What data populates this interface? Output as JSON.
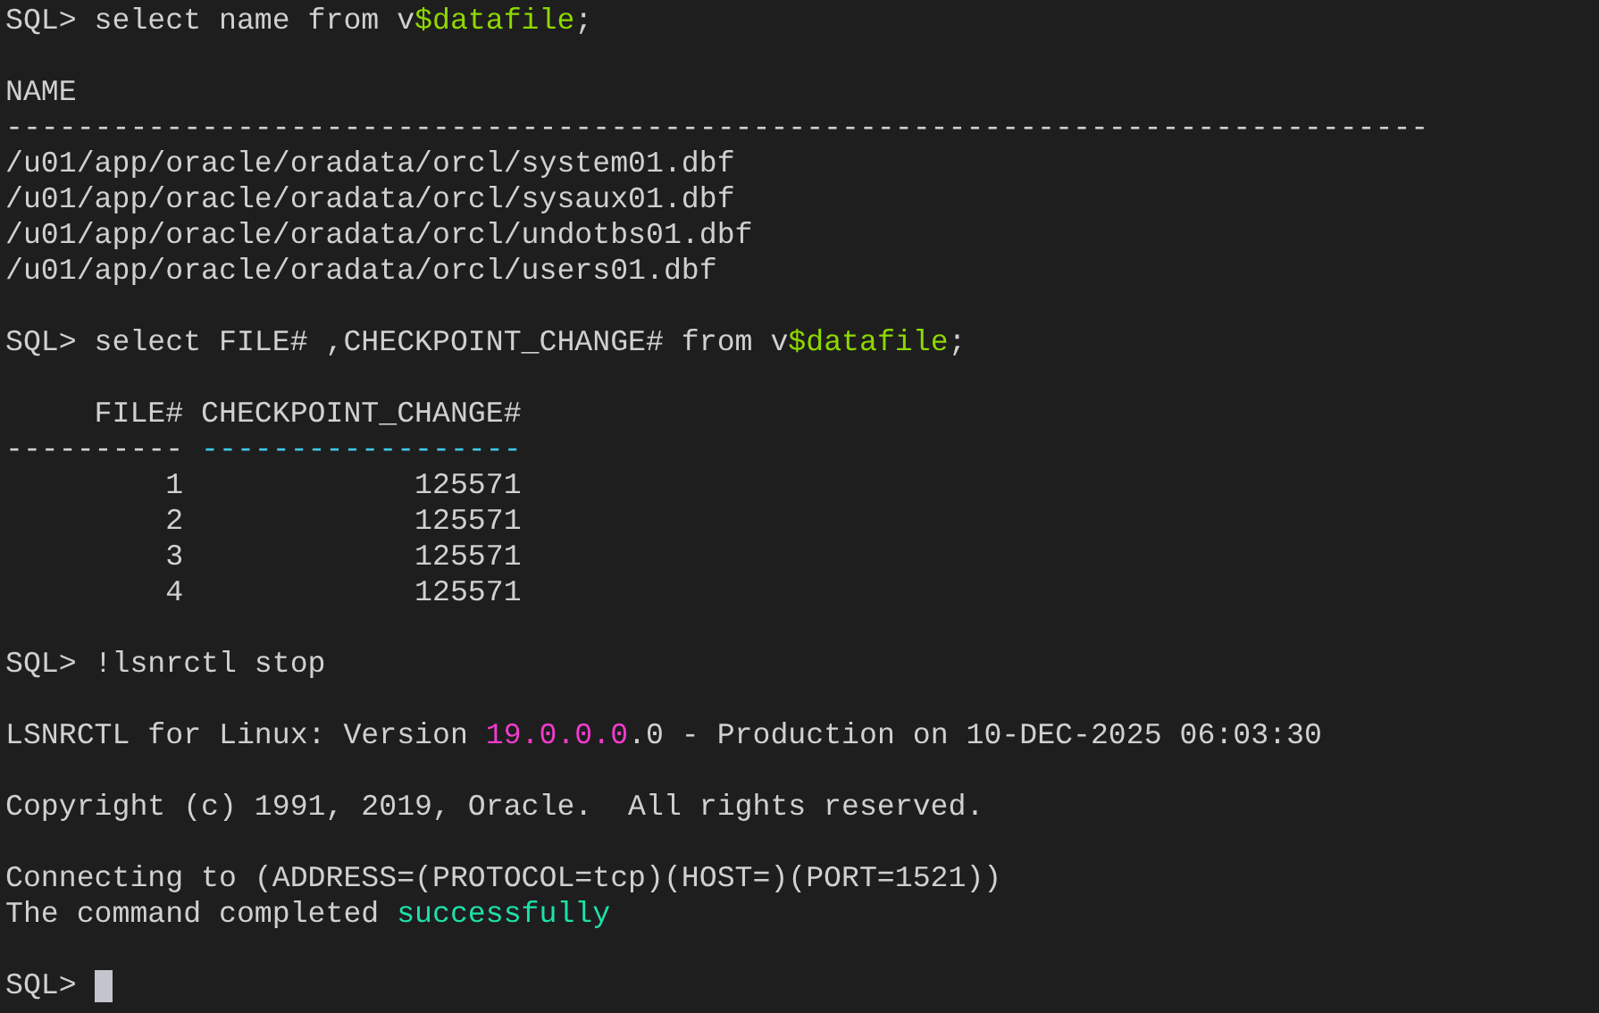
{
  "terminal": {
    "lines": [
      {
        "kind": "text",
        "segments": [
          {
            "text": "SQL> select name from v"
          },
          {
            "text": "$datafile",
            "color": "#8fd800"
          },
          {
            "text": ";"
          }
        ]
      },
      {
        "kind": "blank"
      },
      {
        "kind": "text",
        "segments": [
          {
            "text": "NAME"
          }
        ]
      },
      {
        "kind": "text",
        "segments": [
          {
            "text": "--------------------------------------------------------------------------------"
          }
        ]
      },
      {
        "kind": "text",
        "segments": [
          {
            "text": "/u01/app/oracle/oradata/orcl/system01.dbf"
          }
        ]
      },
      {
        "kind": "text",
        "segments": [
          {
            "text": "/u01/app/oracle/oradata/orcl/sysaux01.dbf"
          }
        ]
      },
      {
        "kind": "text",
        "segments": [
          {
            "text": "/u01/app/oracle/oradata/orcl/undotbs01.dbf"
          }
        ]
      },
      {
        "kind": "text",
        "segments": [
          {
            "text": "/u01/app/oracle/oradata/orcl/users01.dbf"
          }
        ]
      },
      {
        "kind": "blank"
      },
      {
        "kind": "text",
        "segments": [
          {
            "text": "SQL> select FILE# ,CHECKPOINT_CHANGE# from v"
          },
          {
            "text": "$datafile",
            "color": "#8fd800"
          },
          {
            "text": ";"
          }
        ]
      },
      {
        "kind": "blank"
      },
      {
        "kind": "text",
        "segments": [
          {
            "text": "     FILE# CHECKPOINT_CHANGE#"
          }
        ]
      },
      {
        "kind": "text",
        "segments": [
          {
            "text": "---------- "
          },
          {
            "text": "------------------",
            "color": "#3ec8ea"
          }
        ]
      },
      {
        "kind": "text",
        "segments": [
          {
            "text": "         1             125571"
          }
        ]
      },
      {
        "kind": "text",
        "segments": [
          {
            "text": "         2             125571"
          }
        ]
      },
      {
        "kind": "text",
        "segments": [
          {
            "text": "         3             125571"
          }
        ]
      },
      {
        "kind": "text",
        "segments": [
          {
            "text": "         4             125571"
          }
        ]
      },
      {
        "kind": "blank"
      },
      {
        "kind": "text",
        "segments": [
          {
            "text": "SQL> !lsnrctl stop"
          }
        ]
      },
      {
        "kind": "blank"
      },
      {
        "kind": "text",
        "segments": [
          {
            "text": "LSNRCTL for Linux: Version "
          },
          {
            "text": "19.0.0.0",
            "color": "#f03ccc"
          },
          {
            "text": ".0 - Production on 10-DEC-2025 06:03:30"
          }
        ]
      },
      {
        "kind": "blank"
      },
      {
        "kind": "text",
        "segments": [
          {
            "text": "Copyright (c) 1991, 2019, Oracle.  All rights reserved."
          }
        ]
      },
      {
        "kind": "blank"
      },
      {
        "kind": "text",
        "segments": [
          {
            "text": "Connecting to (ADDRESS=(PROTOCOL=tcp)(HOST=)(PORT=1521))"
          }
        ]
      },
      {
        "kind": "text",
        "segments": [
          {
            "text": "The command completed "
          },
          {
            "text": "successfully",
            "color": "#1ee0a8"
          }
        ]
      },
      {
        "kind": "blank"
      },
      {
        "kind": "prompt",
        "segments": [
          {
            "text": "SQL> "
          }
        ],
        "cursor": true
      }
    ]
  }
}
